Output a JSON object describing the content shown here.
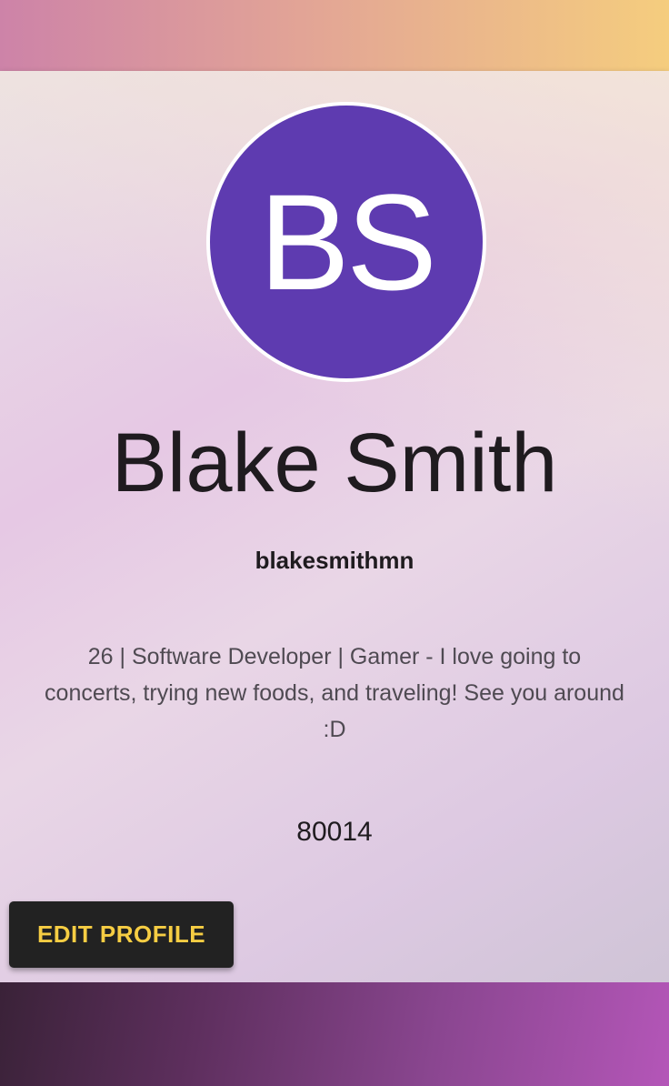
{
  "profile": {
    "initials": "BS",
    "name": "Blake Smith",
    "username": "blakesmithmn",
    "bio": "26 | Software Developer | Gamer - I love going to concerts, trying new foods, and traveling! See you around :D",
    "zip": "80014",
    "avatar_color": "#5e3bb0"
  },
  "actions": {
    "edit_label": "EDIT PROFILE",
    "edit_bg": "#222222",
    "edit_text_color": "#f6cd43"
  }
}
